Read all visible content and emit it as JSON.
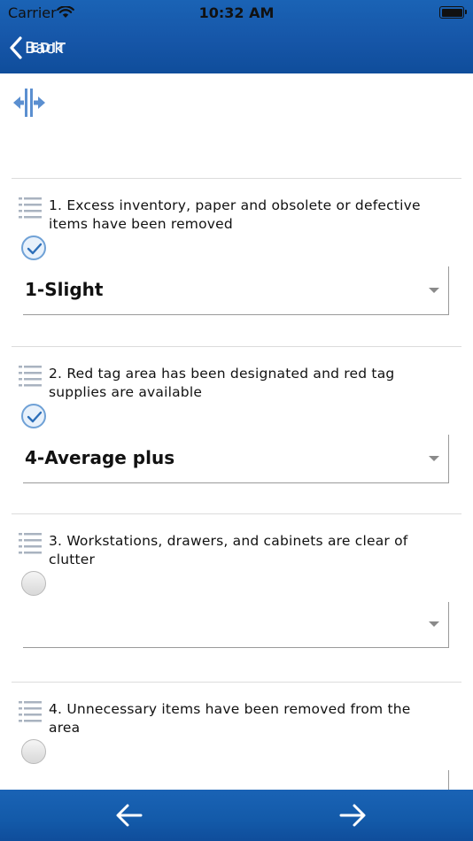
{
  "status_bar": {
    "carrier": "Carrier",
    "time": "10:32 AM"
  },
  "nav": {
    "back_label": "Back",
    "title": "EDIT"
  },
  "colors": {
    "bar_blue": "#1a63b5",
    "check_blue": "#6fa1d6"
  },
  "toolbar_icon": "resize-horizontal-icon",
  "questions": [
    {
      "text": "1. Excess inventory, paper and obsolete or defective items have been removed",
      "checked": true,
      "rating": "1-Slight"
    },
    {
      "text": "2. Red tag area has been designated and red tag supplies are available",
      "checked": true,
      "rating": "4-Average plus"
    },
    {
      "text": "3. Workstations, drawers, and cabinets are clear of clutter",
      "checked": false,
      "rating": ""
    },
    {
      "text": "4. Unnecessary items have been removed from the area",
      "checked": false,
      "rating": ""
    }
  ],
  "bottom_nav": {
    "prev_icon": "arrow-left-icon",
    "next_icon": "arrow-right-icon"
  }
}
